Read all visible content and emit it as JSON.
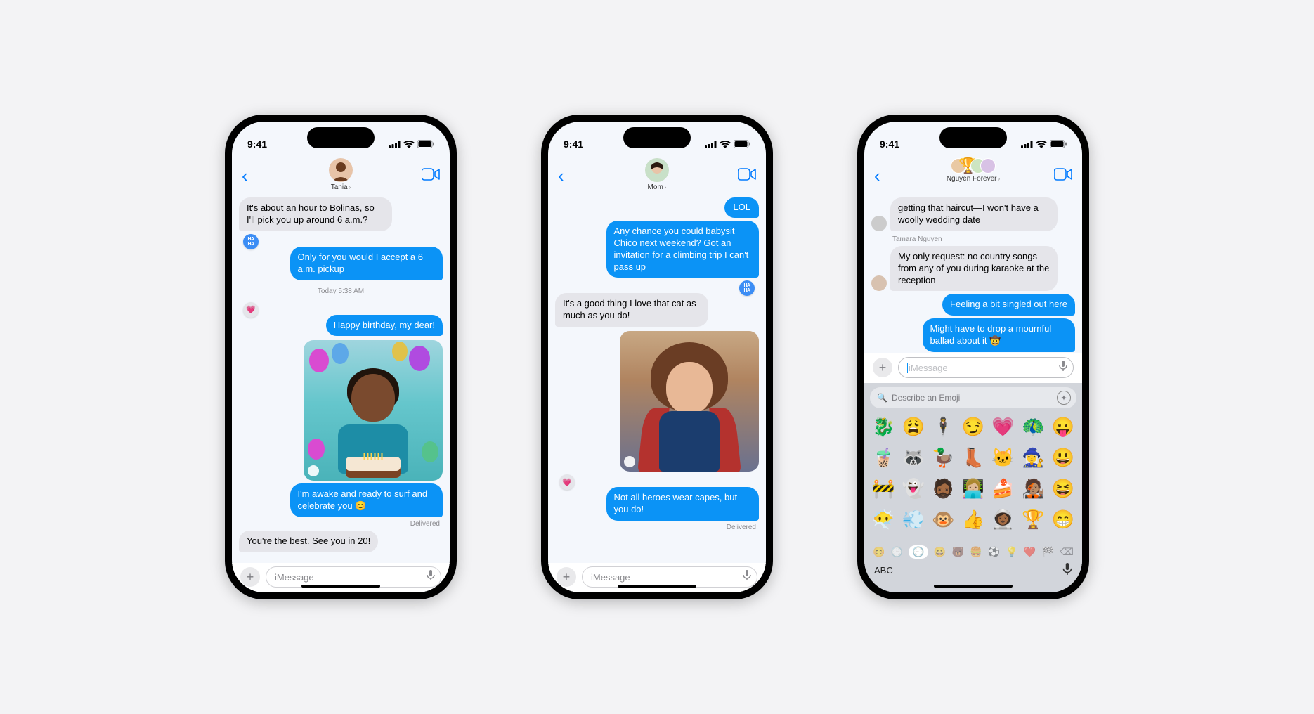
{
  "status": {
    "time": "9:41"
  },
  "phone1": {
    "contact": "Tania",
    "messages": {
      "in1": "It's about an hour to Bolinas, so I'll pick you up around 6 a.m.?",
      "out1": "Only for you would I accept a 6 a.m. pickup",
      "divider": "Today 5:38 AM",
      "out2": "Happy birthday, my dear!",
      "out3": "I'm awake and ready to surf and celebrate you 😊",
      "delivered": "Delivered",
      "in2": "You're the best. See you in 20!"
    },
    "input_placeholder": "iMessage"
  },
  "phone2": {
    "contact": "Mom",
    "messages": {
      "out1": "LOL",
      "out2": "Any chance you could babysit Chico next weekend? Got an invitation for a climbing trip I can't pass up",
      "in1": "It's a good thing I love that cat as much as you do!",
      "out3": "Not all heroes wear capes, but you do!",
      "delivered": "Delivered"
    },
    "input_placeholder": "iMessage"
  },
  "phone3": {
    "contact": "Nguyen Forever",
    "messages": {
      "in1": "getting that haircut—I won't have a woolly wedding date",
      "sender2": "Tamara Nguyen",
      "in2": "My only request: no country songs from any of you during karaoke at the reception",
      "out1": "Feeling a bit singled out here",
      "out2": "Might have to drop a mournful ballad about it 🤠"
    },
    "input_placeholder": "iMessage",
    "emoji_search_placeholder": "Describe an Emoji",
    "abc_label": "ABC",
    "emoji_grid": [
      "🐉",
      "😩",
      "🕴️",
      "😏",
      "💗",
      "🦚",
      "😛",
      "🧋",
      "🦝",
      "🦆",
      "👢",
      "🐱",
      "🧙‍♀️",
      "😃",
      "🚧",
      "👻",
      "🧔🏾",
      "👩🏼‍💻",
      "🍰",
      "🧑🏽‍🎤",
      "😆",
      "😶‍🌫️",
      "💨",
      "🐵",
      "👍",
      "👩🏾‍🚀",
      "🏆",
      "😁"
    ],
    "emoji_tabs": [
      "😊",
      "🕒",
      "🕘",
      "😀",
      "🐻",
      "🍔",
      "⚽",
      "💡",
      "❤️",
      "🏁",
      "⌫"
    ]
  }
}
